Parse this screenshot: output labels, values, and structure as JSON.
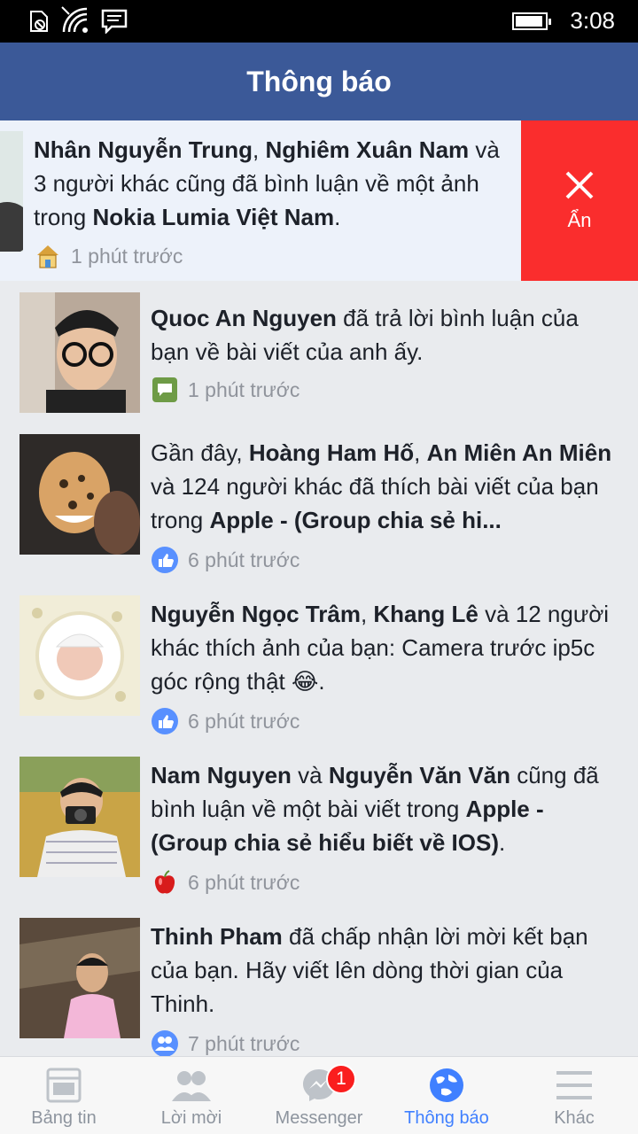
{
  "status_bar": {
    "time": "3:08"
  },
  "header": {
    "title": "Thông báo"
  },
  "hide_action": {
    "label": "Ẩn"
  },
  "notifications": [
    {
      "segments": [
        {
          "t": "Nhân Nguyễn Trung",
          "b": true
        },
        {
          "t": ", "
        },
        {
          "t": "Nghiêm Xuân Nam",
          "b": true
        },
        {
          "t": " và 3 người khác cũng đã bình luận về một ảnh trong "
        },
        {
          "t": "Nokia Lumia Việt Nam",
          "b": true
        },
        {
          "t": "."
        }
      ],
      "time": "1 phút trước",
      "icon": "house-icon"
    },
    {
      "segments": [
        {
          "t": "Quoc An Nguyen",
          "b": true
        },
        {
          "t": " đã trả lời bình luận của bạn về bài viết của anh ấy."
        }
      ],
      "time": "1 phút trước",
      "icon": "comment-icon"
    },
    {
      "segments": [
        {
          "t": "Gần đây, "
        },
        {
          "t": "Hoàng Ham Hố",
          "b": true
        },
        {
          "t": ", "
        },
        {
          "t": "An Miên An Miên",
          "b": true
        },
        {
          "t": " và 124 người khác đã thích bài viết của bạn trong "
        },
        {
          "t": "Apple - (Group chia sẻ hi...",
          "b": true
        }
      ],
      "time": "6 phút trước",
      "icon": "like-icon"
    },
    {
      "segments": [
        {
          "t": "Nguyễn Ngọc Trâm",
          "b": true
        },
        {
          "t": ", "
        },
        {
          "t": "Khang Lê",
          "b": true
        },
        {
          "t": " và 12 người khác thích ảnh của bạn: Camera trước ip5c góc rộng thật 😂."
        }
      ],
      "time": "6 phút trước",
      "icon": "like-icon"
    },
    {
      "segments": [
        {
          "t": "Nam Nguyen",
          "b": true
        },
        {
          "t": " và "
        },
        {
          "t": "Nguyễn Văn Văn",
          "b": true
        },
        {
          "t": " cũng đã bình luận về một bài viết trong "
        },
        {
          "t": "Apple - (Group chia sẻ hiểu biết về IOS)",
          "b": true
        },
        {
          "t": "."
        }
      ],
      "time": "6 phút trước",
      "icon": "apple-icon"
    },
    {
      "segments": [
        {
          "t": "Thinh Pham",
          "b": true
        },
        {
          "t": " đã chấp nhận lời mời kết bạn của bạn. Hãy viết lên dòng thời gian của Thinh."
        }
      ],
      "time": "7 phút trước",
      "icon": "friends-icon"
    }
  ],
  "bottom_nav": [
    {
      "label": "Bảng tin",
      "icon": "news-feed-icon"
    },
    {
      "label": "Lời mời",
      "icon": "friend-requests-icon"
    },
    {
      "label": "Messenger",
      "icon": "messenger-icon",
      "badge": "1"
    },
    {
      "label": "Thông báo",
      "icon": "globe-icon",
      "active": true
    },
    {
      "label": "Khác",
      "icon": "menu-icon"
    }
  ],
  "colors": {
    "brand": "#3b5998",
    "hide_red": "#fa2d2d",
    "active_nav": "#4080ff"
  }
}
